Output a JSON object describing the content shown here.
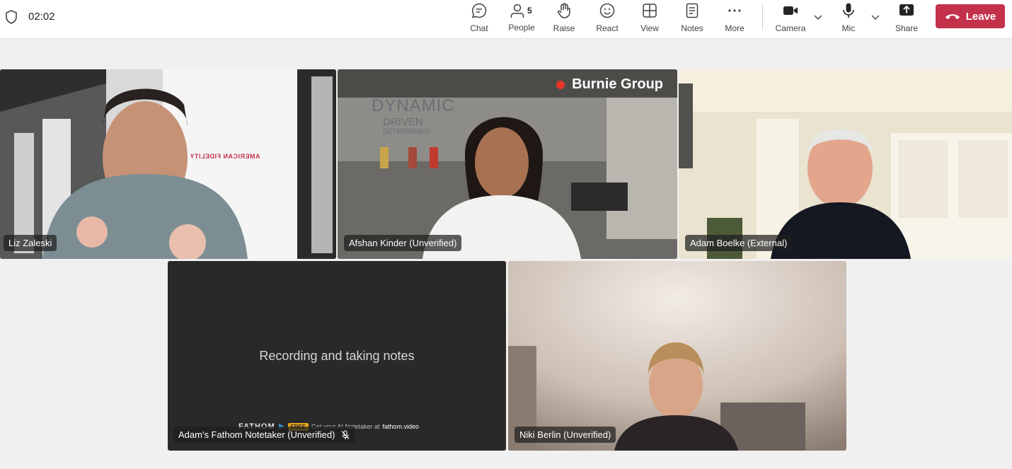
{
  "toolbar": {
    "timer": "02:02",
    "people_count": "5",
    "buttons": {
      "chat": "Chat",
      "people": "People",
      "raise": "Raise",
      "react": "React",
      "view": "View",
      "notes": "Notes",
      "more": "More",
      "camera": "Camera",
      "mic": "Mic",
      "share": "Share"
    },
    "leave": "Leave",
    "leave_color": "#c4314b"
  },
  "participants": [
    {
      "name": "Liz Zaleski",
      "wall_text": "AMERICAN FIDELITY"
    },
    {
      "name": "Afshan Kinder (Unverified)",
      "badge": "Burnie Group",
      "wall_text": [
        "DYNAMIC",
        "DRIVEN",
        "DETERMINED"
      ]
    },
    {
      "name": "Adam Boelke (External)"
    },
    {
      "name": "Adam's Fathom Notetaker (Unverified)",
      "center_text": "Recording and taking notes",
      "fathom_brand": "FATHOM",
      "fathom_free": "FREE",
      "fathom_promo": "Get your AI Notetaker at",
      "fathom_site": "fathom.video"
    },
    {
      "name": "Niki Berlin (Unverified)"
    }
  ]
}
